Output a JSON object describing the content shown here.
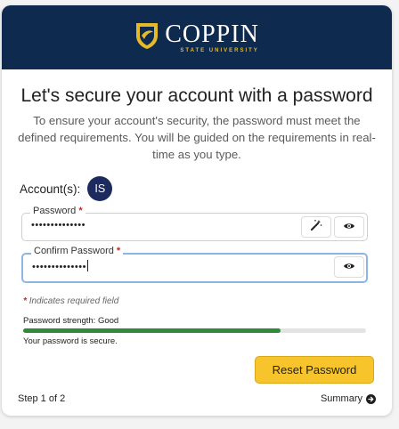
{
  "brand": {
    "name": "COPPIN",
    "subtitle": "STATE UNIVERSITY",
    "navy": "#0e2a4f",
    "gold": "#e6b92a"
  },
  "page": {
    "title": "Let's secure your account with a password",
    "description": "To ensure your account's security, the password must meet the defined requirements. You will be guided on the requirements in real-time as you type."
  },
  "account": {
    "label": "Account(s):",
    "initials": "IS"
  },
  "password_field": {
    "label": "Password",
    "required_mark": "*",
    "masked_value": "••••••••••••••",
    "icons": [
      "magic-wand-icon",
      "eye-icon"
    ]
  },
  "confirm_field": {
    "label": "Confirm Password",
    "required_mark": "*",
    "masked_value": "••••••••••••••",
    "icons": [
      "eye-icon"
    ]
  },
  "required_note": {
    "mark": "*",
    "text": "Indicates required field"
  },
  "strength": {
    "label": "Password strength: Good",
    "level_fraction": 0.75,
    "bar_color": "#2e8b3a",
    "message": "Your password is secure."
  },
  "actions": {
    "reset_label": "Reset Password",
    "reset_color": "#f7c52b"
  },
  "footer": {
    "step": "Step 1 of 2",
    "summary": "Summary"
  }
}
